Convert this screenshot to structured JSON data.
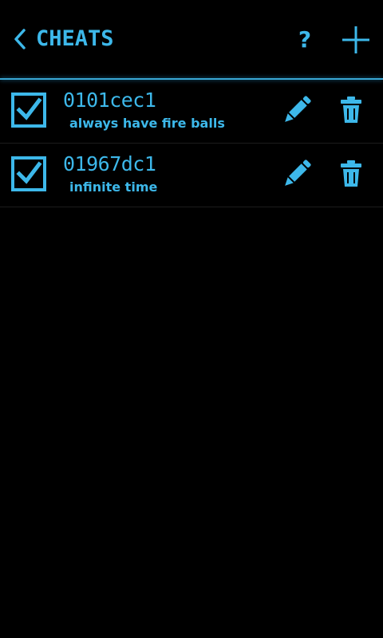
{
  "header": {
    "title": "CHEATS",
    "help_label": "?",
    "back_icon": "chevron-left-icon",
    "add_icon": "plus-icon"
  },
  "colors": {
    "accent": "#3db8ea",
    "background": "#000000",
    "divider": "#1c1c1c"
  },
  "cheats": [
    {
      "code": "0101cec1",
      "description": "always have fire balls",
      "enabled": true
    },
    {
      "code": "01967dc1",
      "description": "infinite time",
      "enabled": true
    }
  ]
}
